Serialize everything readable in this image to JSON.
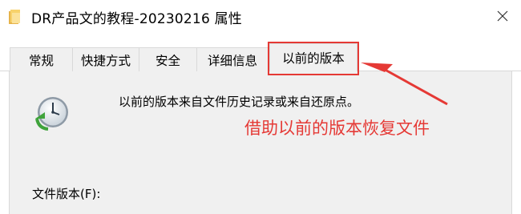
{
  "window": {
    "title": "DR产品文的教程-20230216 属性",
    "folder_icon": "folder-icon",
    "close_icon": "close-icon"
  },
  "tabs": [
    {
      "label": "常规"
    },
    {
      "label": "快捷方式"
    },
    {
      "label": "安全"
    },
    {
      "label": "详细信息"
    },
    {
      "label": "以前的版本"
    }
  ],
  "active_tab": "以前的版本",
  "content": {
    "description": "以前的版本来自文件历史记录或来自还原点。",
    "icon": "restore-clock-icon",
    "file_versions_label": "文件版本(F):"
  },
  "annotation": {
    "text": "借助以前的版本恢复文件",
    "color": "#e53935"
  }
}
